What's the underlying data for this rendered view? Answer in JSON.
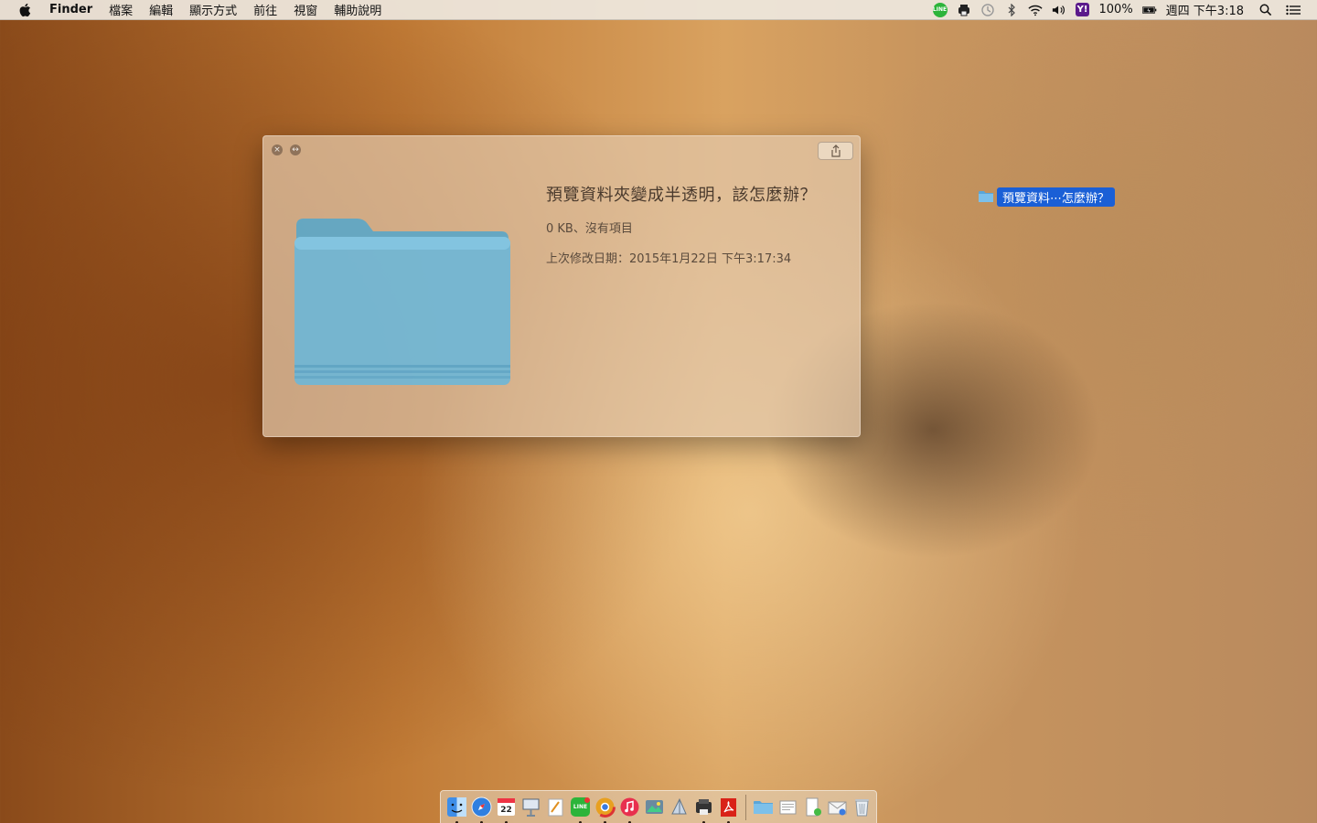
{
  "menubar": {
    "app_name": "Finder",
    "menus": [
      "檔案",
      "編輯",
      "顯示方式",
      "前往",
      "視窗",
      "輔助說明"
    ],
    "status": {
      "line_icon_text": "LINE",
      "yahoo_icon_text": "Y!",
      "battery_percent": "100%",
      "datetime": "週四 下午3:18"
    }
  },
  "quicklook": {
    "title": "預覽資料夾變成半透明，該怎麼辦？",
    "size_info": "0 KB、沒有項目",
    "modified": "上次修改日期：2015年1月22日 下午3:17:34",
    "close_glyph": "×",
    "fullscreen_glyph": "↔"
  },
  "desktop": {
    "selected_item_label": "預覽資料⋯怎麼辦？"
  },
  "dock": {
    "calendar_day": "22",
    "line_badge_text": "LINE"
  },
  "colors": {
    "folder_blue": "#6fb6d6",
    "selection_blue": "#1a5fd6",
    "line_green": "#2cb43a",
    "yahoo_purple": "#5b1a8b"
  }
}
